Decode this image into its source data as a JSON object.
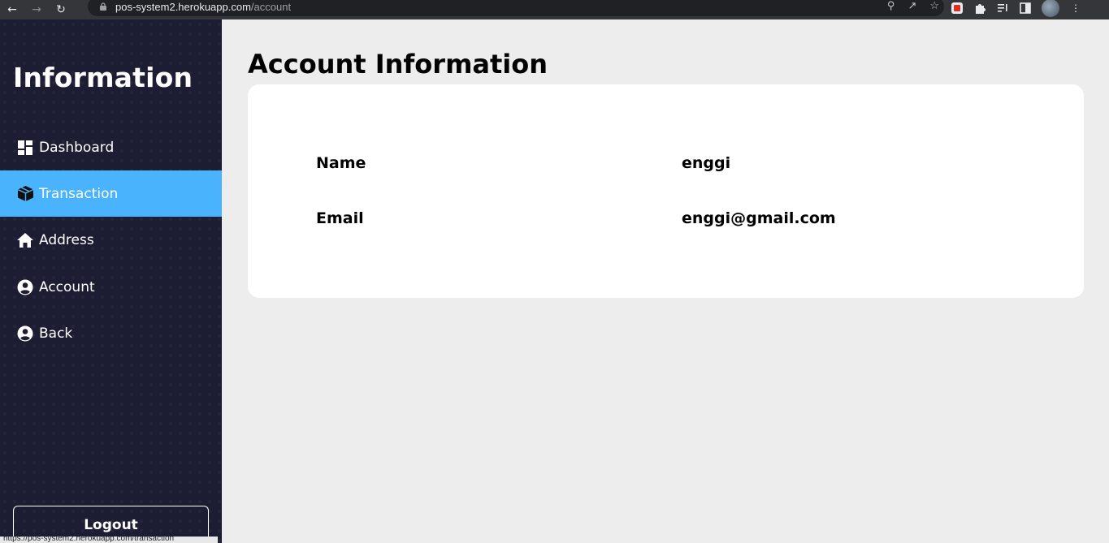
{
  "browser": {
    "url_host": "pos-system2.herokuapp.com",
    "url_path": "/account"
  },
  "sidebar": {
    "brand": "Information",
    "items": [
      {
        "label": "Dashboard",
        "icon": "dashboard-icon",
        "active": false
      },
      {
        "label": "Transaction",
        "icon": "box-icon",
        "active": true
      },
      {
        "label": "Address",
        "icon": "home-icon",
        "active": false
      },
      {
        "label": "Account",
        "icon": "account-circle-icon",
        "active": false
      },
      {
        "label": "Back",
        "icon": "account-circle-icon",
        "active": false
      }
    ],
    "logout_label": "Logout",
    "active_color": "#4ab3fd",
    "background_color": "#1c1c33"
  },
  "main": {
    "title": "Account Information",
    "fields": [
      {
        "label": "Name",
        "value": "enggi"
      },
      {
        "label": "Email",
        "value": "enggi@gmail.com"
      }
    ]
  },
  "status_bar": {
    "url_text": "https://pos-system2.herokuapp.com/transaction"
  }
}
